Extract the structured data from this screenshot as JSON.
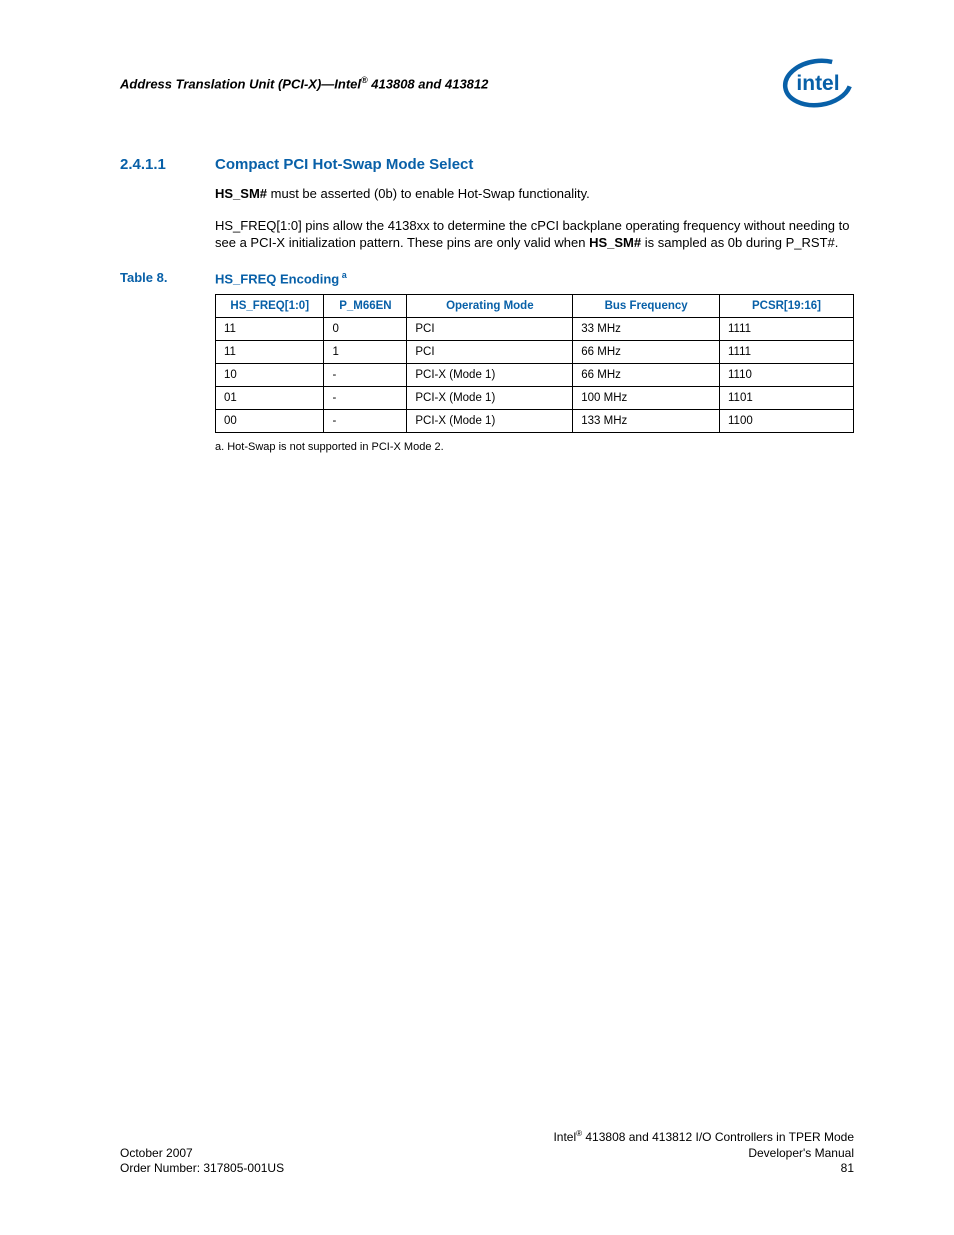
{
  "header": {
    "title_pre": "Address Translation Unit (PCI-X)—Intel",
    "title_post": " 413808 and 413812",
    "reg": "®"
  },
  "section": {
    "number": "2.4.1.1",
    "title": "Compact PCI Hot-Swap Mode Select"
  },
  "para1": {
    "bold1": "HS_SM#",
    "rest": " must be asserted (0b) to enable Hot-Swap functionality."
  },
  "para2": {
    "line1": "HS_FREQ[1:0] pins allow the 4138xx to determine the cPCI backplane operating frequency without needing to see a PCI-X initialization pattern. These pins are only valid when ",
    "bold1": "HS_SM#",
    "line2": " is sampled as 0b during P_RST#."
  },
  "table": {
    "label": "Table 8.",
    "caption": "HS_FREQ Encoding",
    "caption_sup": " a",
    "headers": [
      "HS_FREQ[1:0]",
      "P_M66EN",
      "Operating Mode",
      "Bus Frequency",
      "PCSR[19:16]"
    ],
    "rows": [
      [
        "11",
        "0",
        "PCI",
        "33 MHz",
        "1111"
      ],
      [
        "11",
        "1",
        "PCI",
        "66 MHz",
        "1111"
      ],
      [
        "10",
        "-",
        "PCI-X (Mode 1)",
        "66 MHz",
        "1110"
      ],
      [
        "01",
        "-",
        "PCI-X (Mode 1)",
        "100 MHz",
        "1101"
      ],
      [
        "00",
        "-",
        "PCI-X (Mode 1)",
        "133 MHz",
        "1100"
      ]
    ],
    "footnote": "a.  Hot-Swap is not supported in PCI-X Mode 2."
  },
  "footer": {
    "left_line1": "October 2007",
    "left_line2": "Order Number: 317805-001US",
    "right_line1_pre": "Intel",
    "right_line1_post": " 413808 and 413812 I/O Controllers in TPER Mode",
    "right_line2": "Developer's Manual",
    "right_line3": "81",
    "reg": "®"
  }
}
